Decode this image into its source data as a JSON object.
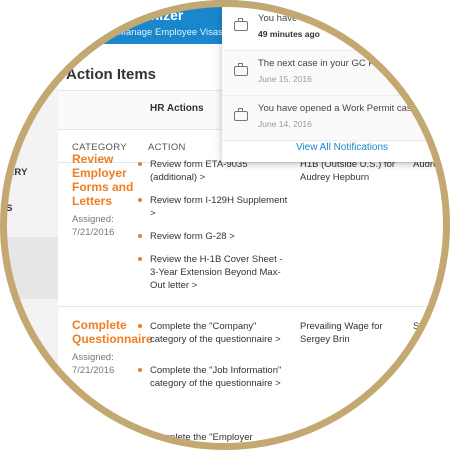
{
  "app": {
    "title": "Organizer",
    "subtitle": "Manage Employee Visas"
  },
  "sidebar": {
    "items": [
      {
        "label": "RARY"
      },
      {
        "label": "TS"
      }
    ]
  },
  "page": {
    "title": "Action Items",
    "tab": "HR Actions"
  },
  "columns": {
    "category": "CATEGORY",
    "action": "ACTION"
  },
  "rows": [
    {
      "category": "Review Employer Forms and Letters",
      "assigned": "Assigned: 7/21/2016",
      "actions": [
        "Review form ETA-9035 (additional) >",
        "Review form I-129H Supplement >",
        "Review form G-28 >",
        "Review the H-1B Cover Sheet - 3-Year Extension Beyond Max-Out letter >"
      ],
      "who": "H1B (Outside U.S.) for Audrey Hepburn",
      "who2": "Audrey Hepburn"
    },
    {
      "category": "Complete Questionnaire",
      "assigned": "Assigned: 7/21/2016",
      "actions": [
        "Complete the \"Company\" category of the questionnaire >",
        "Complete the \"Job Information\" category of the questionnaire >",
        "Complete the \"Employer"
      ],
      "who": "Prevailing Wage for Sergey Brin",
      "who2": "Se"
    }
  ],
  "notifications": {
    "items": [
      {
        "text": "You have opened a P",
        "time": "49 minutes ago"
      },
      {
        "text": "The next case in your GC Product",
        "time": "June 15, 2016"
      },
      {
        "text": "You have opened a Work Permit case with",
        "time": "June 14, 2016"
      }
    ],
    "view_all": "View All Notifications"
  },
  "colors": {
    "header_blue": "#1a87cd",
    "accent_orange": "#ef7d22",
    "frame_gold": "#c3a871"
  }
}
